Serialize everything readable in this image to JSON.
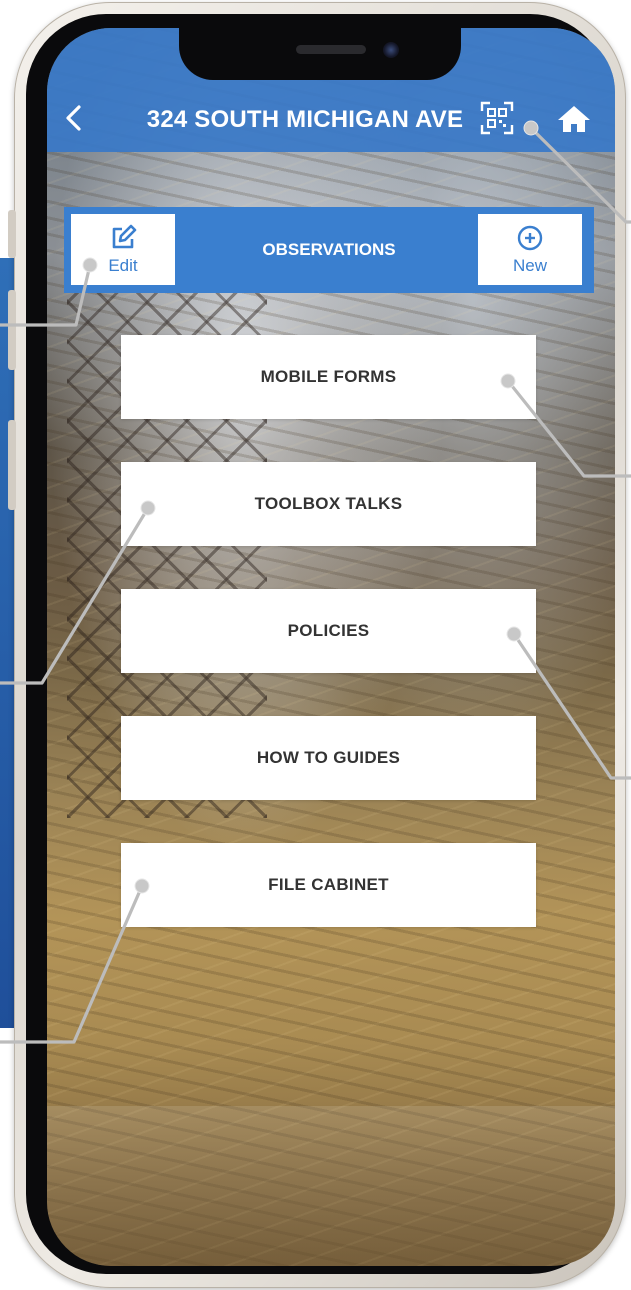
{
  "header": {
    "back_icon": "chevron-left-icon",
    "title": "324 SOUTH MICHIGAN AVE",
    "qr_icon": "qr-code-icon",
    "home_icon": "home-icon",
    "background_color": "#3878C8"
  },
  "observations": {
    "title": "OBSERVATIONS",
    "edit_label": "Edit",
    "edit_icon": "edit-icon",
    "new_label": "New",
    "new_icon": "plus-circle-icon",
    "accent_color": "#3A7FCF"
  },
  "menu": {
    "items": [
      {
        "label": "MOBILE FORMS"
      },
      {
        "label": "TOOLBOX TALKS"
      },
      {
        "label": "POLICIES"
      },
      {
        "label": "HOW TO GUIDES"
      },
      {
        "label": "FILE CABINET"
      }
    ]
  },
  "colors": {
    "menu_text": "#333333",
    "callout_line": "#b5b5b5"
  }
}
